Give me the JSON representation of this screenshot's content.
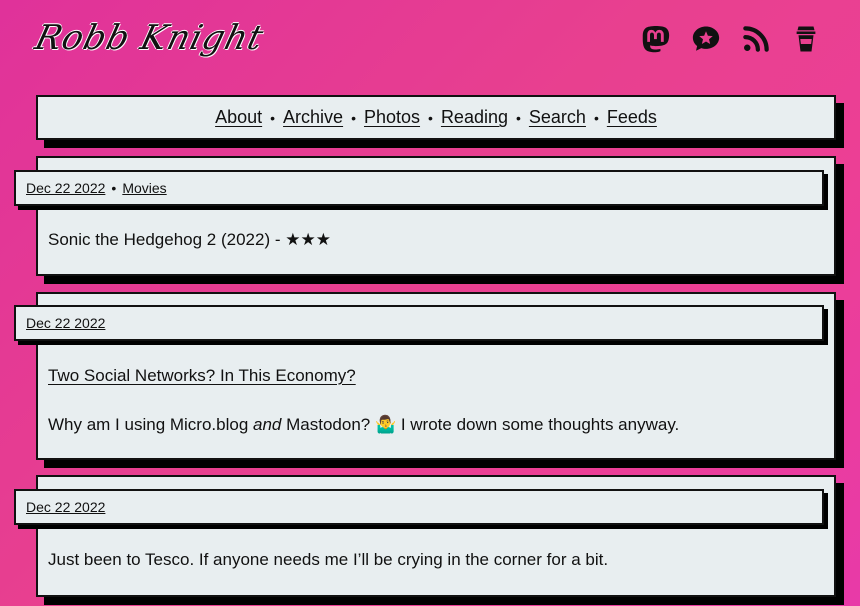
{
  "site": {
    "logo": "Robb Knight"
  },
  "social": [
    {
      "icon": "mastodon-icon"
    },
    {
      "icon": "microblog-icon"
    },
    {
      "icon": "rss-icon"
    },
    {
      "icon": "coffee-cup-icon"
    }
  ],
  "nav": {
    "items": [
      "About",
      "Archive",
      "Photos",
      "Reading",
      "Search",
      "Feeds"
    ],
    "separator": "•"
  },
  "posts": [
    {
      "date": "Dec 22 2022",
      "category": "Movies",
      "text": "Sonic the Hedgehog 2 (2022) - ★★★"
    },
    {
      "date": "Dec 22 2022",
      "title": "Two Social Networks? In This Economy?",
      "text_before": "Why am I using Micro.blog ",
      "text_em": "and",
      "text_after": " Mastodon? 🤷‍♂️ I wrote down some thoughts anyway."
    },
    {
      "date": "Dec 22 2022",
      "text": "Just been to Tesco. If anyone needs me I’ll be crying in the corner for a bit."
    }
  ]
}
